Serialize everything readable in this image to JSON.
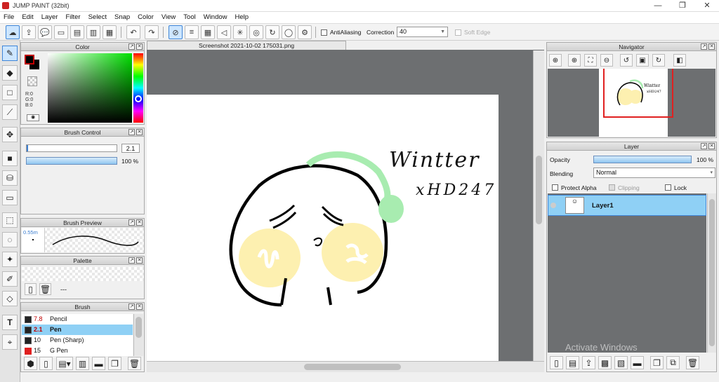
{
  "window": {
    "title": "JUMP PAINT (32bit)",
    "minimize": "—",
    "maximize": "❐",
    "close": "✕"
  },
  "menu": [
    "File",
    "Edit",
    "Layer",
    "Filter",
    "Select",
    "Snap",
    "Color",
    "View",
    "Tool",
    "Window",
    "Help"
  ],
  "toolbar": {
    "antialiasing_label": "AntiAliasing",
    "correction_label": "Correction",
    "correction_value": "40",
    "soft_edge_label": "Soft Edge"
  },
  "document_tab": "Screenshot 2021-10-02 175031.png",
  "color_panel": {
    "title": "Color",
    "r": "R:0",
    "g": "G:0",
    "b": "B:0",
    "fg": "#c00000",
    "bg": "#000000"
  },
  "brush_control": {
    "title": "Brush Control",
    "size": "2.1",
    "opacity": "100 %",
    "opacity_fraction": 1.0
  },
  "brush_preview": {
    "title": "Brush Preview",
    "size": "0.55m"
  },
  "palette": {
    "title": "Palette",
    "value": "---"
  },
  "brush": {
    "title": "Brush",
    "items": [
      {
        "size": "7.8",
        "name": "Pencil",
        "color": "#222222",
        "selected": false
      },
      {
        "size": "2.1",
        "name": "Pen",
        "color": "#222222",
        "selected": true
      },
      {
        "size": "10",
        "name": "Pen (Sharp)",
        "color": "#222222",
        "selected": false
      },
      {
        "size": "15",
        "name": "G Pen",
        "color": "#e02020",
        "selected": false
      }
    ]
  },
  "navigator": {
    "title": "Navigator"
  },
  "layer_panel": {
    "title": "Layer",
    "opacity_label": "Opacity",
    "opacity_value": "100 %",
    "blending_label": "Blending",
    "blending_value": "Normal",
    "protect_alpha": "Protect Alpha",
    "clipping": "Clipping",
    "lock": "Lock",
    "layers": [
      {
        "name": "Layer1"
      }
    ]
  },
  "artwork": {
    "text1": "Wintter",
    "text2": "xHD247"
  },
  "watermark": "Activate Windows"
}
